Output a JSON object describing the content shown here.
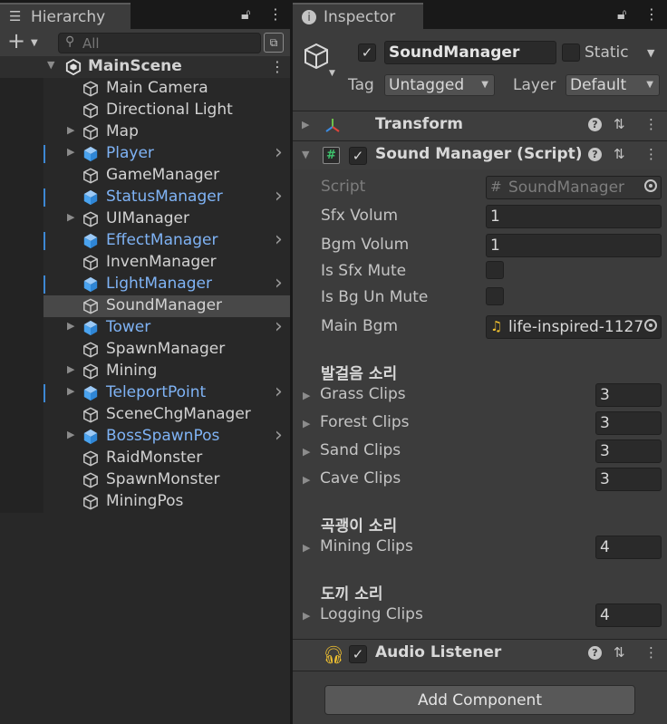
{
  "hierarchy": {
    "tab_label": "Hierarchy",
    "tab_icon": "hierarchy-list-icon",
    "search_placeholder": "All",
    "scene_name": "MainScene",
    "items": [
      {
        "label": "Main Camera",
        "prefab": false,
        "expandable": false
      },
      {
        "label": "Directional Light",
        "prefab": false,
        "expandable": false
      },
      {
        "label": "Map",
        "prefab": false,
        "expandable": true
      },
      {
        "label": "Player",
        "prefab": true,
        "expandable": true
      },
      {
        "label": "GameManager",
        "prefab": false,
        "expandable": false
      },
      {
        "label": "StatusManager",
        "prefab": true,
        "expandable": false
      },
      {
        "label": "UIManager",
        "prefab": false,
        "expandable": true
      },
      {
        "label": "EffectManager",
        "prefab": true,
        "expandable": false
      },
      {
        "label": "InvenManager",
        "prefab": false,
        "expandable": false
      },
      {
        "label": "LightManager",
        "prefab": true,
        "expandable": false
      },
      {
        "label": "SoundManager",
        "prefab": false,
        "expandable": false,
        "selected": true
      },
      {
        "label": "Tower",
        "prefab": true,
        "expandable": true
      },
      {
        "label": "SpawnManager",
        "prefab": false,
        "expandable": false
      },
      {
        "label": "Mining",
        "prefab": false,
        "expandable": true
      },
      {
        "label": "TeleportPoint",
        "prefab": true,
        "expandable": true
      },
      {
        "label": "SceneChgManager",
        "prefab": false,
        "expandable": false
      },
      {
        "label": "BossSpawnPos",
        "prefab": true,
        "expandable": true
      },
      {
        "label": "RaidMonster",
        "prefab": false,
        "expandable": false
      },
      {
        "label": "SpawnMonster",
        "prefab": false,
        "expandable": false
      },
      {
        "label": "MiningPos",
        "prefab": false,
        "expandable": false
      }
    ]
  },
  "inspector": {
    "tab_label": "Inspector",
    "tab_icon": "info-icon",
    "object_name": "SoundManager",
    "active": true,
    "static_label": "Static",
    "tag_label": "Tag",
    "tag_value": "Untagged",
    "layer_label": "Layer",
    "layer_value": "Default",
    "components": {
      "transform": {
        "title": "Transform"
      },
      "sound_manager": {
        "title": "Sound Manager (Script)"
      },
      "audio_listener": {
        "title": "Audio Listener"
      }
    },
    "fields": {
      "script_label": "Script",
      "script_value": "SoundManager",
      "sfx_volum_label": "Sfx Volum",
      "sfx_volum_value": "1",
      "bgm_volum_label": "Bgm Volum",
      "bgm_volum_value": "1",
      "is_sfx_mute_label": "Is Sfx Mute",
      "is_bg_un_mute_label": "Is Bg Un Mute",
      "main_bgm_label": "Main Bgm",
      "main_bgm_value": "life-inspired-1127"
    },
    "section_footsteps": "발걸음 소리",
    "grass_label": "Grass Clips",
    "grass_value": "3",
    "forest_label": "Forest Clips",
    "forest_value": "3",
    "sand_label": "Sand Clips",
    "sand_value": "3",
    "cave_label": "Cave Clips",
    "cave_value": "3",
    "section_pickaxe": "곡괭이 소리",
    "mining_label": "Mining Clips",
    "mining_value": "4",
    "section_axe": "도끼 소리",
    "logging_label": "Logging Clips",
    "logging_value": "4",
    "add_component_label": "Add Component"
  },
  "colors": {
    "prefab_text": "#7fb3f5",
    "selection_row": "#484848",
    "panel_bg": "#3c3c3c",
    "hierarchy_bg": "#282828",
    "audio_icon": "#f2c230",
    "script_icon": "#3ec46d"
  }
}
